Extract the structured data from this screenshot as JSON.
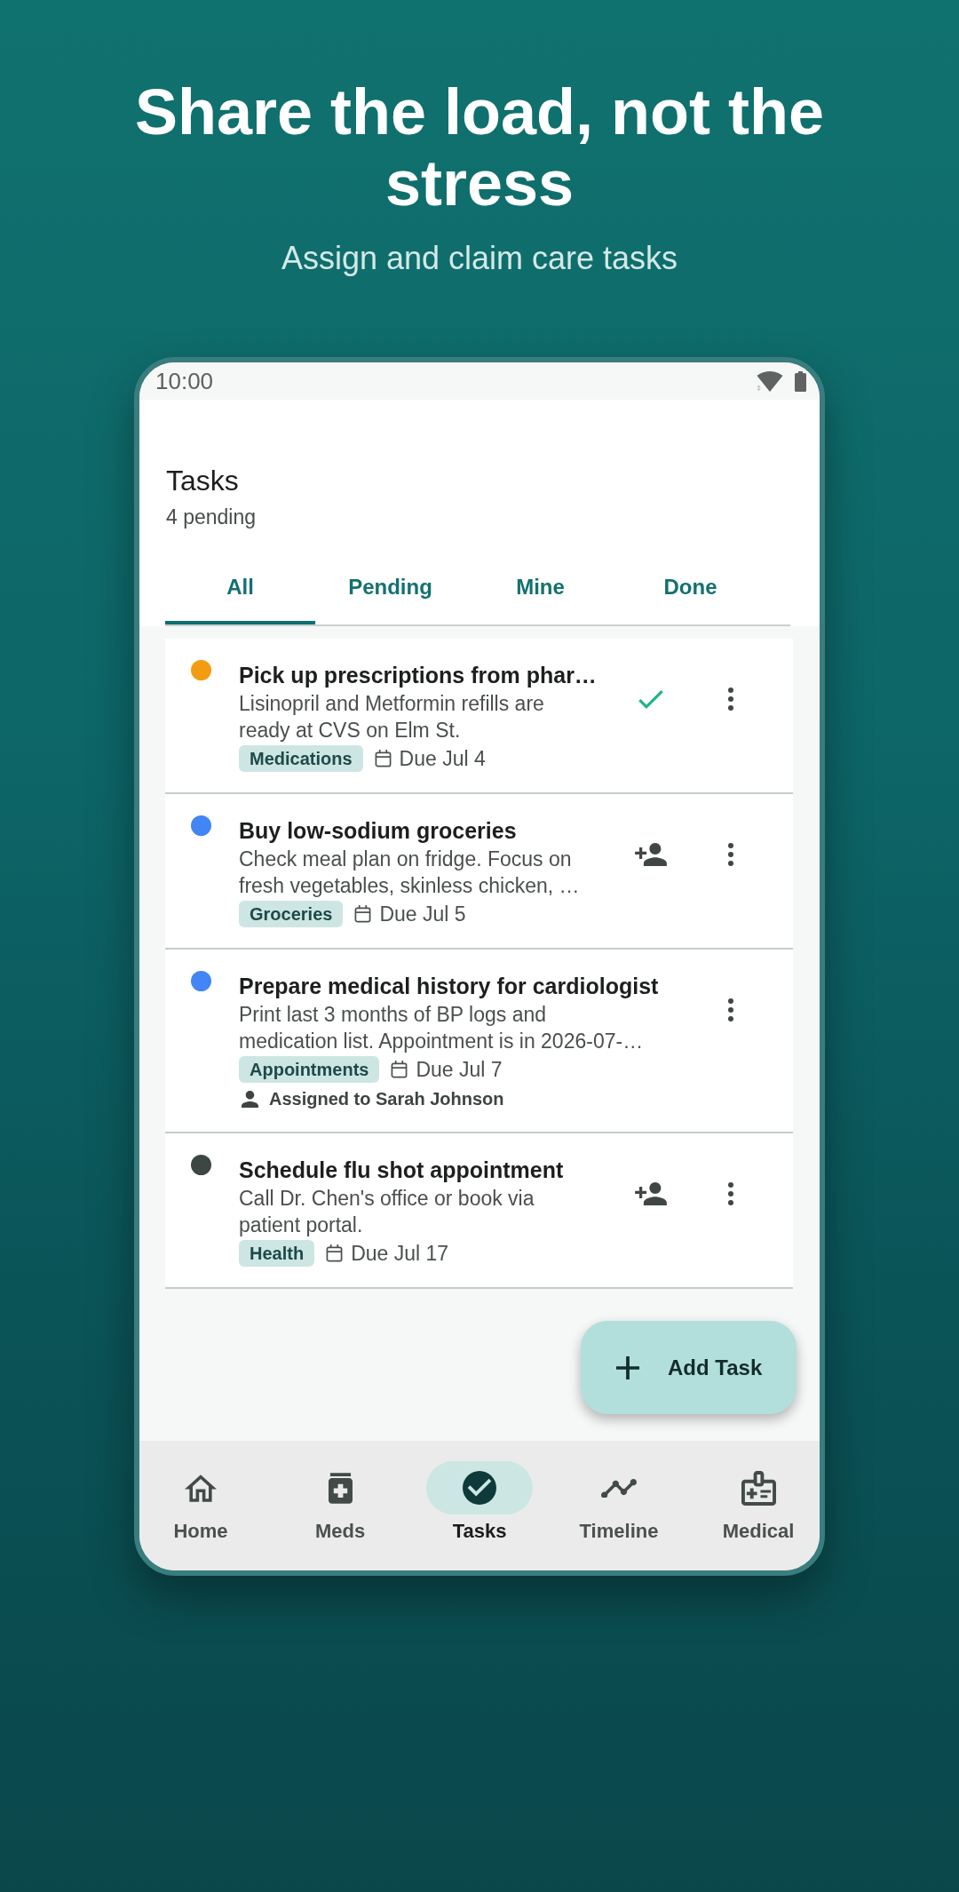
{
  "header": {
    "title": "Share the load, not the stress",
    "subtitle": "Assign and claim care tasks"
  },
  "status_bar": {
    "time": "10:00"
  },
  "app_bar": {
    "title": "Tasks",
    "subtitle": "4 pending"
  },
  "tabs": [
    {
      "label": "All",
      "selected": true
    },
    {
      "label": "Pending",
      "selected": false
    },
    {
      "label": "Mine",
      "selected": false
    },
    {
      "label": "Done",
      "selected": false
    }
  ],
  "tasks": [
    {
      "kind": "check",
      "title": "Pick up prescriptions from phar…",
      "description": "Lisinopril and Metformin refills are ready at CVS on Elm St.",
      "color": "#f39c12",
      "tag": "Medications",
      "due": "Due Jul 4"
    },
    {
      "kind": "claim",
      "title": "Buy low-sodium groceries",
      "description": "Check meal plan on fridge. Focus on fresh vegetables, skinless chicken, …",
      "color": "#4285f4",
      "tag": "Groceries",
      "due": "Due Jul 5"
    },
    {
      "kind": "assigned",
      "title": "Prepare medical history for cardiologist",
      "description": "Print last 3 months of BP logs and medication list. Appointment is in 2026-07-…",
      "color": "#4285f4",
      "tag": "Appointments",
      "due": "Due Jul 7",
      "assigned": "Assigned to Sarah Johnson"
    },
    {
      "kind": "claim",
      "title": "Schedule flu shot appointment",
      "description": "Call Dr. Chen's office or book via patient portal.",
      "color": "#3c4643",
      "tag": "Health",
      "due": "Due Jul 17"
    }
  ],
  "fab": {
    "label": "Add Task"
  },
  "nav": [
    {
      "label": "Home",
      "selected": false
    },
    {
      "label": "Meds",
      "selected": false
    },
    {
      "label": "Tasks",
      "selected": true
    },
    {
      "label": "Timeline",
      "selected": false
    },
    {
      "label": "Medical",
      "selected": false
    }
  ]
}
